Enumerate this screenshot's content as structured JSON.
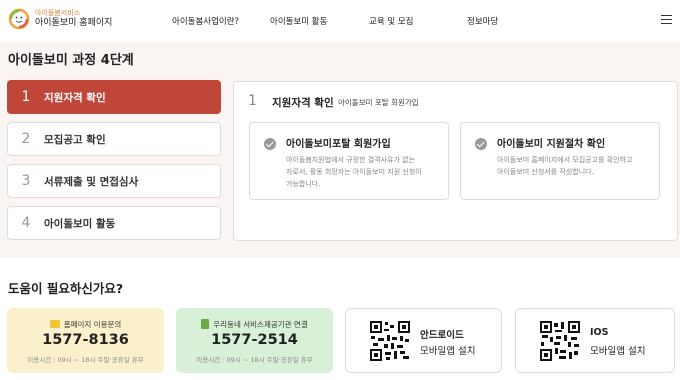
{
  "header": {
    "logo_top": "아이돌봄서비스",
    "logo_bottom": "아이돌보미 홈페이지",
    "nav": [
      "아이돌봄사업이란?",
      "아이돌보미 활동",
      "교육 및 모집",
      "정보마당"
    ]
  },
  "process": {
    "title": "아이돌보미 과정 4단계",
    "steps": [
      {
        "num": "1",
        "label": "지원자격 확인"
      },
      {
        "num": "2",
        "label": "모집공고 확인"
      },
      {
        "num": "3",
        "label": "서류제출 및 면접심사"
      },
      {
        "num": "4",
        "label": "아이돌보미 활동"
      }
    ],
    "detail": {
      "num": "1",
      "title": "지원자격 확인",
      "subtitle": "아이돌보미 포탈 회원가입",
      "cards": [
        {
          "title": "아이돌보미포탈 회원가입",
          "lines": [
            "아이돌봄지원법에서 규정한 결격사유가 없는",
            "자로서, 활동 희망자는 아이돌보미 지원 신청이",
            "가능합니다."
          ]
        },
        {
          "title": "아이돌보미 지원절차 확인",
          "lines": [
            "아이돌보미 홈페이지에서 모집공고를 확인하고",
            "아이돌보미 신청서를 작성합니다."
          ]
        }
      ]
    }
  },
  "help": {
    "title": "도움이 필요하신가요?",
    "homepage": {
      "label": "홈페이지 이용문의",
      "phone": "1577-8136",
      "hours": "이용시간 : 09시 ~ 18시 주말·공휴일 휴무"
    },
    "community": {
      "label": "우리동네 서비스제공기관 연결",
      "phone": "1577-2514",
      "hours": "이용시간 : 09시 ~ 18시 주말·공휴일 휴무"
    },
    "android": {
      "line1": "안드로이드",
      "line2": "모바일앱 설치"
    },
    "ios": {
      "line1": "IOS",
      "line2": "모바일앱 설치"
    }
  },
  "colors": {
    "accent": "#c0463a",
    "section_bg": "#faf5f3",
    "yellow_card": "#fbf0cc",
    "green_card": "#d8f0d8"
  }
}
